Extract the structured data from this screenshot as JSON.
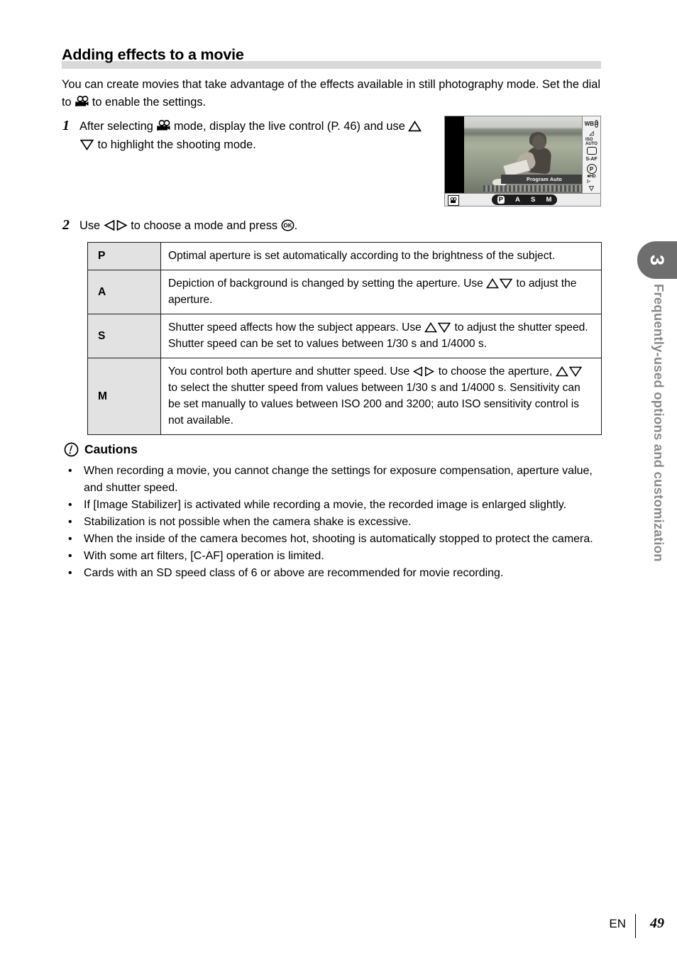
{
  "heading": {
    "title": "Adding effects to a movie"
  },
  "intro": {
    "text_part1": "You can create movies that take advantage of the effects available in still photography mode. Set the dial to ",
    "icon": "movie-camera-icon",
    "text_part2": " to enable the settings."
  },
  "steps": [
    {
      "number": "1",
      "text_part1": "After selecting ",
      "icon1": "movie-camera-icon",
      "text_part2": " mode, display the live control (P. 46) and use ",
      "icon2": "up-triangle-icon",
      "icon3": "down-triangle-icon",
      "text_part3": " to highlight the shooting mode."
    },
    {
      "number": "2",
      "text_part1": "Use ",
      "icon1": "left-triangle-icon",
      "icon2": "right-triangle-icon",
      "text_part2": " to choose a mode and press ",
      "icon3": "ok-button-icon",
      "text_part3": "."
    }
  ],
  "camera_figure": {
    "caption_label": "Program Auto",
    "mode_bar": {
      "selected": "P",
      "options": [
        "P",
        "A",
        "S",
        "M"
      ]
    },
    "movie_badge": "movie-mode-icon",
    "side_icons": [
      "white-balance-icon",
      "art-filter-icon",
      "iso-auto-icon",
      "aspect-ratio-icon",
      "s-af-icon",
      "program-auto-icon",
      "movie-quality-icon",
      "scroll-down-icon"
    ]
  },
  "mode_table": {
    "rows": [
      {
        "key": "P",
        "description": "Optimal aperture is set automatically according to the brightness of the subject."
      },
      {
        "key": "A",
        "desc_part1": "Depiction of background is changed by setting the aperture. Use ",
        "icon1": "up-triangle-icon",
        "icon2": "down-triangle-icon",
        "desc_part2": " to adjust the aperture."
      },
      {
        "key": "S",
        "desc_part1": "Shutter speed affects how the subject appears. Use ",
        "icon1": "up-triangle-icon",
        "icon2": "down-triangle-icon",
        "desc_part2": " to adjust the shutter speed. Shutter speed can be set to values between 1/30 s and 1/4000 s."
      },
      {
        "key": "M",
        "desc_part1": "You control both aperture and shutter speed. Use ",
        "icon1": "left-triangle-icon",
        "icon2": "right-triangle-icon",
        "desc_part2": " to choose the aperture, ",
        "icon3": "up-triangle-icon",
        "icon4": "down-triangle-icon",
        "desc_part3": " to select the shutter speed from values between 1/30 s and 1/4000 s. Sensitivity can be set manually to values between ISO 200 and 3200; auto ISO sensitivity control is not available."
      }
    ]
  },
  "cautions": {
    "icon": "exclamation-circle-icon",
    "title": "Cautions",
    "bullet": "•",
    "items": [
      "When recording a movie, you cannot change the settings for exposure compensation, aperture value, and shutter speed.",
      "If [Image Stabilizer] is activated while recording a movie, the recorded image is enlarged slightly.",
      "Stabilization is not possible when the camera shake is excessive.",
      "When the inside of the camera becomes hot, shooting is automatically stopped to protect the camera.",
      "With some art filters, [C-AF] operation is limited.",
      "Cards with an SD speed class of 6 or above are recommended for movie recording."
    ]
  },
  "chapter": {
    "number": "3",
    "title": "Frequently-used options and customization",
    "tab_color": "#6e6e6e",
    "title_color": "#8a8a8a"
  },
  "footer": {
    "language": "EN",
    "page_number": "49"
  }
}
